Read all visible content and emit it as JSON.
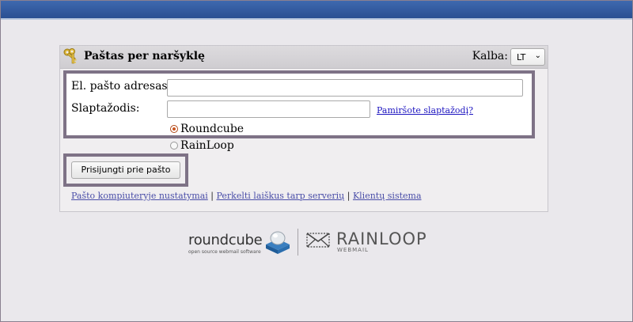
{
  "header": {
    "title": "Paštas per naršyklę",
    "language_label": "Kalba:",
    "language_value": "LT"
  },
  "form": {
    "email_label": "El. pašto adresas:",
    "email_value": "",
    "password_label": "Slaptažodis:",
    "password_value": "",
    "forgot_link": "Pamiršote slaptažodį?",
    "clients": [
      {
        "label": "Roundcube",
        "selected": true
      },
      {
        "label": "RainLoop",
        "selected": false
      }
    ],
    "submit_label": "Prisijungti prie pašto"
  },
  "links": [
    "Pašto kompiuteryje nustatymai",
    "Perkelti laiškus tarp serverių",
    "Klientų sistema"
  ],
  "link_separator": "|",
  "logos": {
    "roundcube_name": "roundcube",
    "roundcube_tagline": "open source webmail software",
    "rainloop_name": "RAINLOOP",
    "rainloop_tagline": "WEBMAIL"
  },
  "colors": {
    "topbar": "#2f5799",
    "highlight_border": "#7e7286",
    "link": "#1d15c0",
    "radio_accent": "#c9531f"
  },
  "icons": {
    "panel": "keys-icon",
    "language": "chevron-down-icon"
  }
}
